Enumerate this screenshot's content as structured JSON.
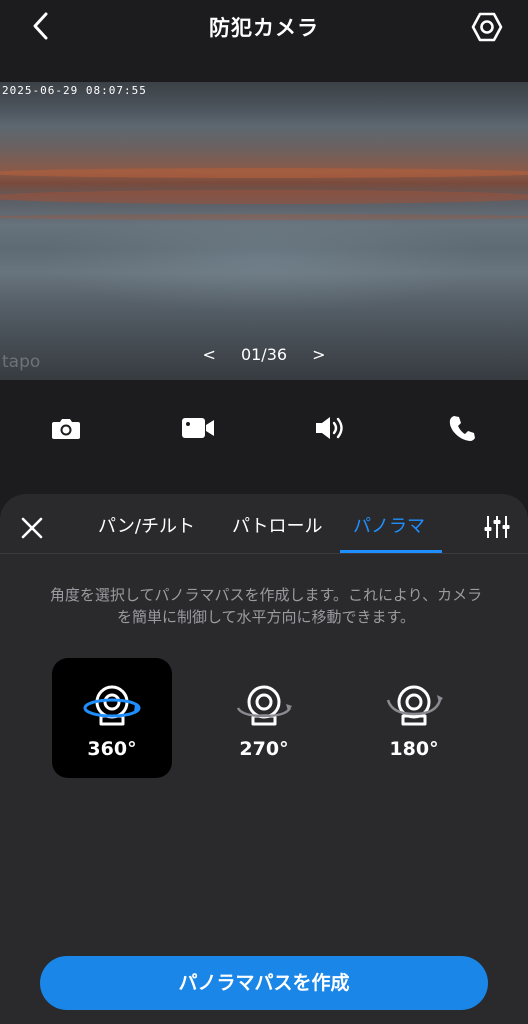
{
  "header": {
    "title": "防犯カメラ"
  },
  "video": {
    "timestamp": "2025-06-29 08:07:55",
    "watermark": "tapo",
    "pager": {
      "prev": "<",
      "current": "01/36",
      "next": ">"
    }
  },
  "controls": {
    "items": [
      {
        "name": "snapshot",
        "icon": "camera-icon"
      },
      {
        "name": "record",
        "icon": "video-icon"
      },
      {
        "name": "speaker",
        "icon": "speaker-icon"
      },
      {
        "name": "call",
        "icon": "phone-icon"
      }
    ]
  },
  "panel": {
    "tabs": [
      {
        "label": "パン/チルト",
        "active": false
      },
      {
        "label": "パトロール",
        "active": false
      },
      {
        "label": "パノラマ",
        "active": true
      }
    ],
    "accent_color": "#1f8fff",
    "description": "角度を選択してパノラマパスを作成します。これにより、カメラを簡単に制御して水平方向に移動できます。",
    "options": [
      {
        "label": "360°",
        "selected": true
      },
      {
        "label": "270°",
        "selected": false
      },
      {
        "label": "180°",
        "selected": false
      }
    ],
    "create_button": "パノラマパスを作成",
    "button_color": "#1a86e8"
  }
}
